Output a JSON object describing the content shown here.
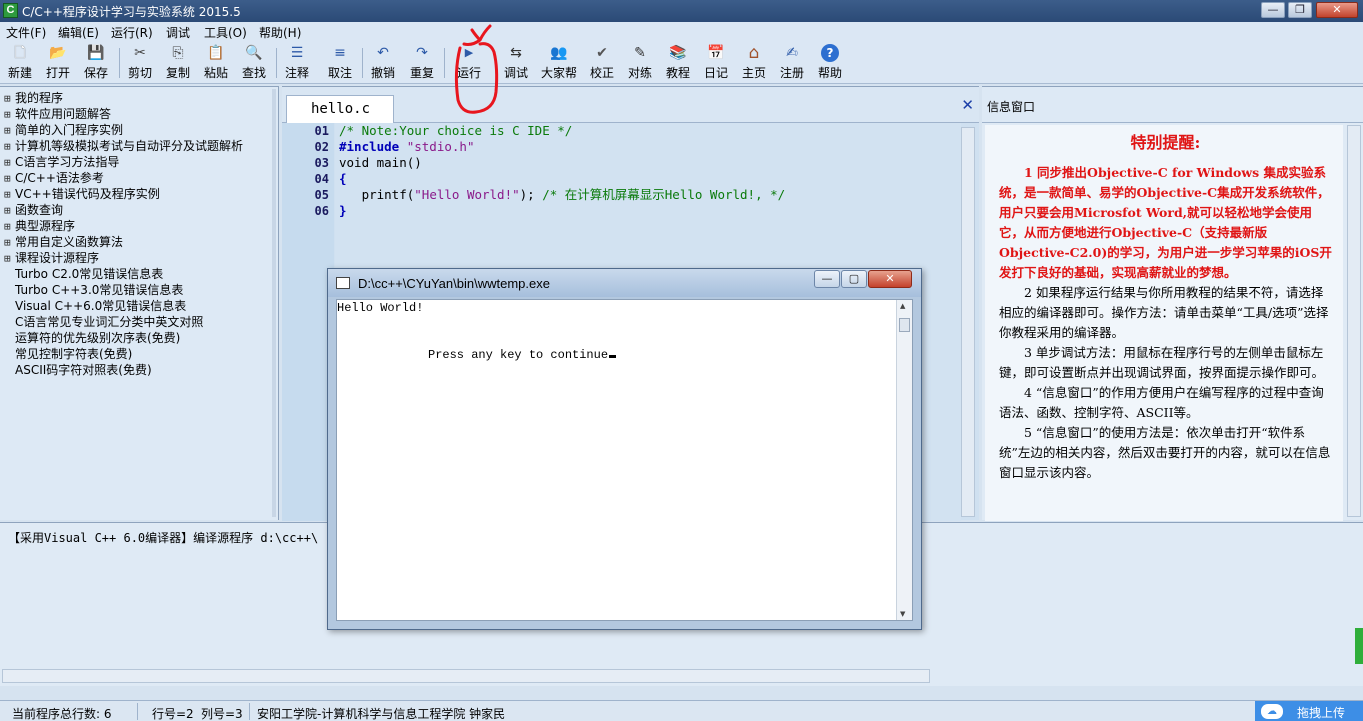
{
  "window": {
    "title": "C/C++程序设计学习与实验系统 2015.5",
    "app_icon_letter": "C",
    "buttons": {
      "minimize": "—",
      "maximize": "❐",
      "close": "✕"
    }
  },
  "menu": {
    "items": [
      {
        "label": "文件(F)"
      },
      {
        "label": "编辑(E)"
      },
      {
        "label": "运行(R)"
      },
      {
        "label": "调试"
      },
      {
        "label": "工具(O)"
      },
      {
        "label": "帮助(H)"
      }
    ]
  },
  "toolbar": {
    "buttons": [
      {
        "label": "新建",
        "icon": "new-file-icon",
        "glyph": "🗋"
      },
      {
        "label": "打开",
        "icon": "open-folder-icon",
        "glyph": "📂"
      },
      {
        "label": "保存",
        "icon": "save-disk-icon",
        "glyph": "💾"
      },
      {
        "label": "剪切",
        "icon": "scissors-icon",
        "glyph": "✂"
      },
      {
        "label": "复制",
        "icon": "copy-icon",
        "glyph": "⎘"
      },
      {
        "label": "粘贴",
        "icon": "paste-icon",
        "glyph": "📋"
      },
      {
        "label": "查找",
        "icon": "binoculars-icon",
        "glyph": "🔍"
      },
      {
        "label": "注释",
        "icon": "comment-icon",
        "glyph": "☰"
      },
      {
        "label": "取注",
        "icon": "uncomment-icon",
        "glyph": "≡"
      },
      {
        "label": "撤销",
        "icon": "undo-icon",
        "glyph": "↶"
      },
      {
        "label": "重复",
        "icon": "redo-icon",
        "glyph": "↷"
      },
      {
        "label": "运行",
        "icon": "run-icon",
        "glyph": "▶"
      },
      {
        "label": "调试",
        "icon": "debug-icon",
        "glyph": "⇆"
      },
      {
        "label": "大家帮",
        "icon": "people-icon",
        "glyph": "👥"
      },
      {
        "label": "校正",
        "icon": "check-icon",
        "glyph": "✔"
      },
      {
        "label": "对练",
        "icon": "edit-icon",
        "glyph": "✎"
      },
      {
        "label": "教程",
        "icon": "books-icon",
        "glyph": "📚"
      },
      {
        "label": "日记",
        "icon": "diary-icon",
        "glyph": "📅"
      },
      {
        "label": "主页",
        "icon": "home-icon",
        "glyph": "⌂"
      },
      {
        "label": "注册",
        "icon": "register-pen-icon",
        "glyph": "✍"
      },
      {
        "label": "帮助",
        "icon": "help-icon",
        "glyph": "?"
      }
    ]
  },
  "tree": {
    "items": [
      {
        "label": "我的程序",
        "expandable": true
      },
      {
        "label": "软件应用问题解答",
        "expandable": true
      },
      {
        "label": "简单的入门程序实例",
        "expandable": true
      },
      {
        "label": "计算机等级模拟考试与自动评分及试题解析",
        "expandable": true
      },
      {
        "label": "C语言学习方法指导",
        "expandable": true
      },
      {
        "label": "C/C++语法参考",
        "expandable": true
      },
      {
        "label": "VC++错误代码及程序实例",
        "expandable": true
      },
      {
        "label": "函数查询",
        "expandable": true
      },
      {
        "label": "典型源程序",
        "expandable": true
      },
      {
        "label": "常用自定义函数算法",
        "expandable": true
      },
      {
        "label": "课程设计源程序",
        "expandable": true
      },
      {
        "label": "Turbo C2.0常见错误信息表",
        "expandable": false
      },
      {
        "label": "Turbo C++3.0常见错误信息表",
        "expandable": false
      },
      {
        "label": "Visual C++6.0常见错误信息表",
        "expandable": false
      },
      {
        "label": "C语言常见专业词汇分类中英文对照",
        "expandable": false
      },
      {
        "label": "运算符的优先级别次序表(免费)",
        "expandable": false
      },
      {
        "label": "常见控制字符表(免费)",
        "expandable": false
      },
      {
        "label": "ASCII码字符对照表(免费)",
        "expandable": false
      }
    ]
  },
  "editor": {
    "tab_label": "hello.c",
    "close_glyph": "✕",
    "line_numbers": [
      "01",
      "02",
      "03",
      "04",
      "05",
      "06"
    ],
    "lines": [
      [
        {
          "text": "/* Note:Your choice is C IDE */",
          "cls": "c-com"
        }
      ],
      [
        {
          "text": "#include ",
          "cls": "c-kw"
        },
        {
          "text": "\"stdio.h\"",
          "cls": "c-str"
        }
      ],
      [
        {
          "text": "void main()",
          "cls": "c-plain"
        }
      ],
      [
        {
          "text": "{",
          "cls": "c-kw"
        }
      ],
      [
        {
          "text": "   printf(",
          "cls": "c-plain"
        },
        {
          "text": "\"Hello World!\"",
          "cls": "c-str"
        },
        {
          "text": "); ",
          "cls": "c-plain"
        },
        {
          "text": "/* 在计算机屏幕显示Hello World!, */",
          "cls": "c-com"
        }
      ],
      [
        {
          "text": "}",
          "cls": "c-kw"
        }
      ]
    ]
  },
  "info": {
    "title": "信息窗口",
    "heading": "特别提醒:",
    "paragraphs": [
      {
        "text": "1 同步推出Objective-C for Windows 集成实验系统，是一款简单、易学的Objective-C集成开发系统软件，用户只要会用Microsfot Word,就可以轻松地学会使用它，从而方便地进行Objective-C（支持最新版Objective-C2.0)的学习，为用户进一步学习苹果的iOS开发打下良好的基础，实现高薪就业的梦想。",
        "red": true
      },
      {
        "text": "2 如果程序运行结果与你所用教程的结果不符，请选择相应的编译器即可。操作方法：请单击菜单“工具/选项”选择你教程采用的编译器。",
        "red": false
      },
      {
        "text": "3 单步调试方法：用鼠标在程序行号的左侧单击鼠标左键，即可设置断点并出现调试界面，按界面提示操作即可。",
        "red": false
      },
      {
        "text": "4 “信息窗口”的作用方便用户在编写程序的过程中查询语法、函数、控制字符、ASCII等。",
        "red": false
      },
      {
        "text": "5 “信息窗口”的使用方法是：依次单击打开“软件系统”左边的相关内容，然后双击要打开的内容，就可以在信息窗口显示该内容。",
        "red": false
      }
    ]
  },
  "output": {
    "text": "【采用Visual C++ 6.0编译器】编译源程序 d:\\cc++\\"
  },
  "console": {
    "title": "D:\\cc++\\CYuYan\\bin\\wwtemp.exe",
    "line1": "Hello World!",
    "line2": "Press any key to continue",
    "buttons": {
      "minimize": "—",
      "maximize": "▢",
      "close": "✕"
    }
  },
  "status": {
    "total_lines": "当前程序总行数:  6",
    "line_no": "行号=2",
    "col_no": "列号=3",
    "school": "安阳工学院-计算机科学与信息工程学院  钟家民",
    "upload_label": "拖拽上传",
    "upload_icon": "cloud-icon"
  },
  "colors": {
    "annotation_red": "#e8161e",
    "heading_red": "#e01515",
    "comment_green": "#0a7a0a",
    "keyword_blue": "#0000b8",
    "upload_blue": "#3d8ee6"
  }
}
